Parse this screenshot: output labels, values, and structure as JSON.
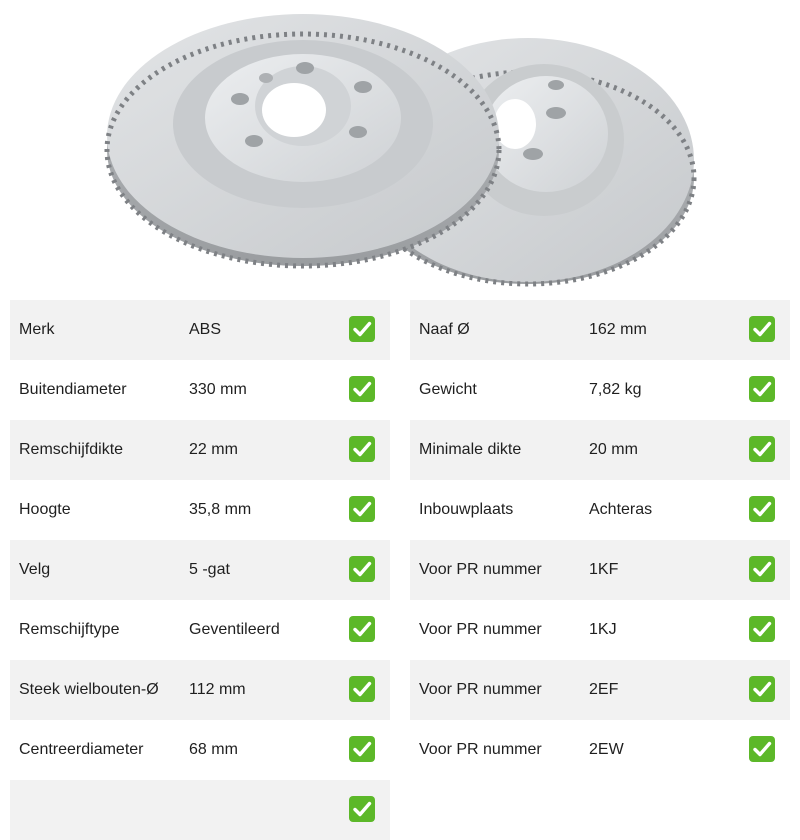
{
  "colors": {
    "row_shade": "#f2f2f2",
    "check_green": "#5cb829",
    "check_mark": "#ffffff",
    "disc_grey": "#d4d6d8"
  },
  "product_image": {
    "subject": "two vented brake discs, 5 bolt holes",
    "icon": "brake-disc-icon"
  },
  "check_icon": "white-check-mark-on-green",
  "specs_left": [
    {
      "label": "Merk",
      "value": "ABS"
    },
    {
      "label": "Buitendiameter",
      "value": "330 mm"
    },
    {
      "label": "Remschijfdikte",
      "value": "22 mm"
    },
    {
      "label": "Hoogte",
      "value": "35,8 mm"
    },
    {
      "label": "Velg",
      "value": "5 -gat"
    },
    {
      "label": "Remschijftype",
      "value": "Geventileerd"
    },
    {
      "label": "Steek wielbouten-Ø",
      "value": "112 mm"
    },
    {
      "label": "Centreerdiameter",
      "value": "68 mm"
    },
    {
      "label": "",
      "value": ""
    }
  ],
  "specs_right": [
    {
      "label": "Naaf Ø",
      "value": "162 mm"
    },
    {
      "label": "Gewicht",
      "value": "7,82 kg"
    },
    {
      "label": "Minimale dikte",
      "value": "20 mm"
    },
    {
      "label": "Inbouwplaats",
      "value": "Achteras"
    },
    {
      "label": "Voor PR nummer",
      "value": "1KF"
    },
    {
      "label": "Voor PR nummer",
      "value": "1KJ"
    },
    {
      "label": "Voor PR nummer",
      "value": "2EF"
    },
    {
      "label": "Voor PR nummer",
      "value": "2EW"
    }
  ]
}
